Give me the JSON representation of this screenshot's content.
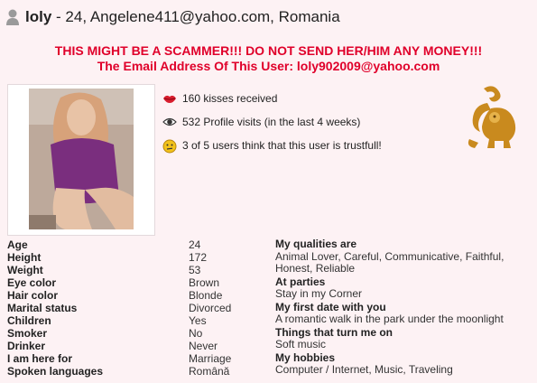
{
  "header": {
    "icon": "person-icon",
    "name": "loly",
    "rest": " - 24, Angelene411@yahoo.com, Romania"
  },
  "warning": {
    "line1": "THIS MIGHT BE A SCAMMER!!! DO NOT SEND HER/HIM ANY MONEY!!!",
    "line2": "The Email Address Of This User: loly902009@yahoo.com",
    "color": "#e0002a"
  },
  "stats": [
    {
      "icon": "lips-icon",
      "text": "160 kisses received"
    },
    {
      "icon": "eye-icon",
      "text": "532 Profile visits (in the last 4 weeks)"
    },
    {
      "icon": "smiley-icon",
      "text": "3 of 5 users think that this user is trustfull!"
    }
  ],
  "zodiac_icon": "leo-zodiac-icon",
  "details": [
    {
      "label": "Age",
      "value": "24"
    },
    {
      "label": "Height",
      "value": "172"
    },
    {
      "label": "Weight",
      "value": "53"
    },
    {
      "label": "Eye color",
      "value": "Brown"
    },
    {
      "label": "Hair color",
      "value": "Blonde"
    },
    {
      "label": "Marital status",
      "value": "Divorced"
    },
    {
      "label": "Children",
      "value": "Yes"
    },
    {
      "label": "Smoker",
      "value": "No"
    },
    {
      "label": "Drinker",
      "value": "Never"
    },
    {
      "label": "I am here for",
      "value": "Marriage"
    },
    {
      "label": "Spoken languages",
      "value": "Română"
    }
  ],
  "about": [
    {
      "heading": "My qualities are",
      "text": "Animal Lover, Careful, Communicative, Faithful, Honest, Reliable"
    },
    {
      "heading": "At parties",
      "text": "Stay in my Corner"
    },
    {
      "heading": "My first date with you",
      "text": "A romantic walk in the park under the moonlight"
    },
    {
      "heading": "Things that turn me on",
      "text": "Soft music"
    },
    {
      "heading": "My hobbies",
      "text": "Computer / Internet, Music, Traveling"
    }
  ]
}
